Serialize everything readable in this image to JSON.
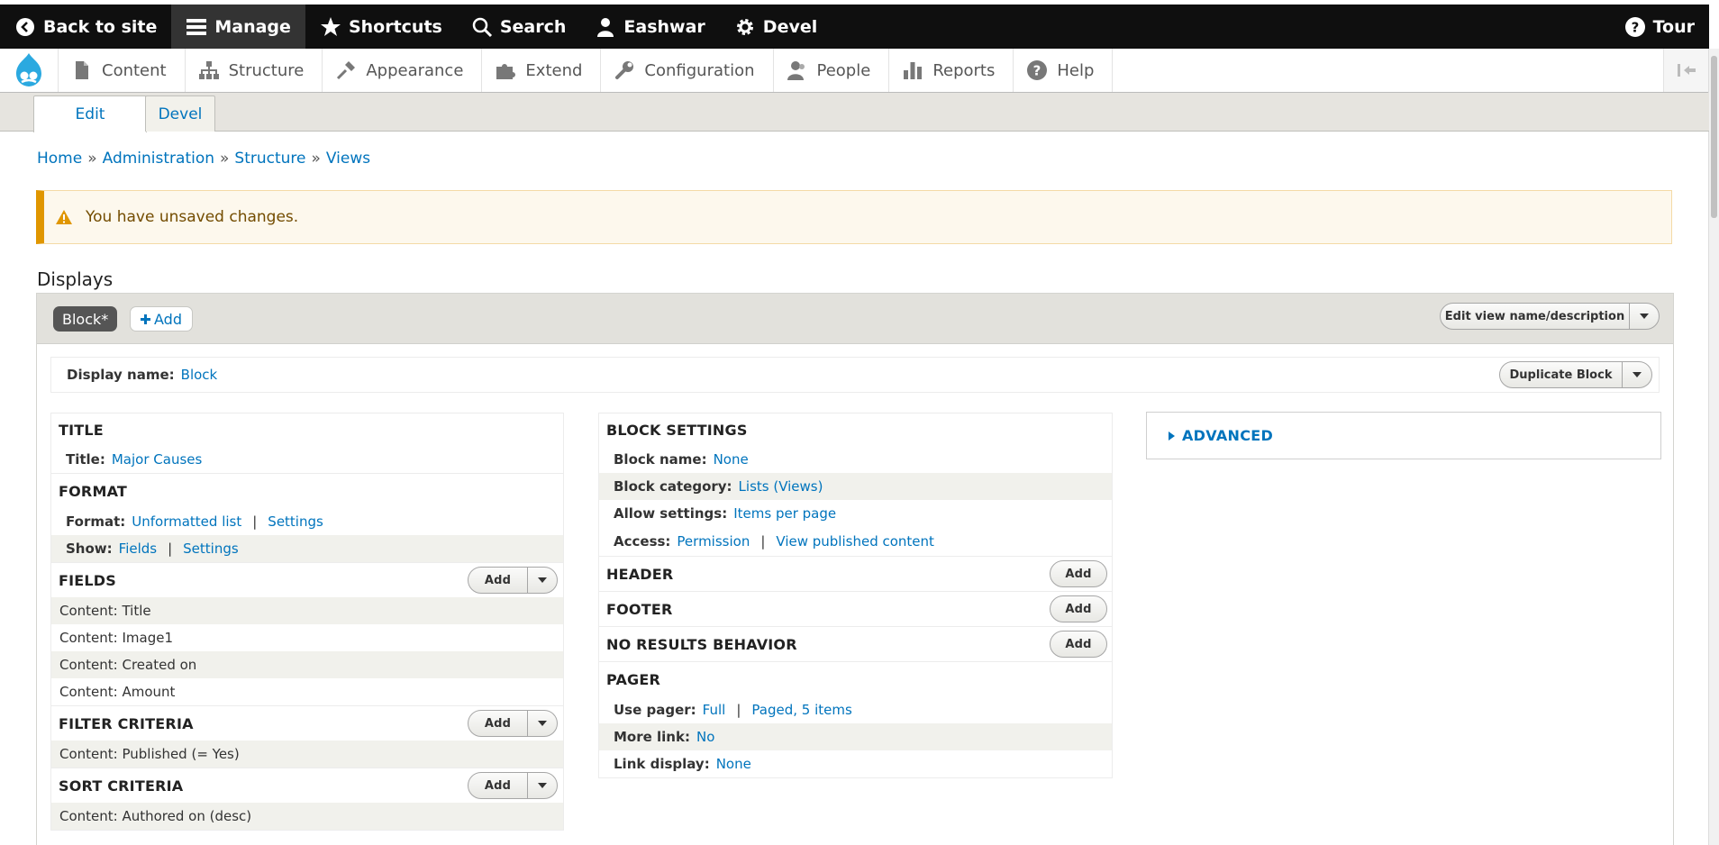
{
  "toolbar": {
    "back": "Back to site",
    "manage": "Manage",
    "shortcuts": "Shortcuts",
    "search": "Search",
    "user": "Eashwar",
    "devel": "Devel",
    "tour": "Tour"
  },
  "tray": {
    "items": [
      "Content",
      "Structure",
      "Appearance",
      "Extend",
      "Configuration",
      "People",
      "Reports",
      "Help"
    ]
  },
  "tabs": [
    "Edit",
    "Devel"
  ],
  "breadcrumb": [
    "Home",
    "Administration",
    "Structure",
    "Views"
  ],
  "breadcrumb_sep": "»",
  "warning": "You have unsaved changes.",
  "displays": {
    "title": "Displays",
    "active_display": "Block*",
    "add_label": "Add",
    "edit_view_button": "Edit view name/description",
    "display_name_label": "Display name:",
    "display_name_value": "Block",
    "duplicate_button": "Duplicate Block"
  },
  "left": {
    "title_section": "TITLE",
    "title_label": "Title:",
    "title_value": "Major Causes",
    "format_section": "FORMAT",
    "format_label": "Format:",
    "format_value": "Unformatted list",
    "settings": "Settings",
    "show_label": "Show:",
    "show_value": "Fields",
    "fields_section": "FIELDS",
    "fields": [
      "Content: Title",
      "Content: Image1",
      "Content: Created on",
      "Content: Amount"
    ],
    "filter_section": "FILTER CRITERIA",
    "filters": [
      "Content: Published (= Yes)"
    ],
    "sort_section": "SORT CRITERIA",
    "sorts": [
      "Content: Authored on (desc)"
    ],
    "add_button": "Add"
  },
  "middle": {
    "block_settings": "BLOCK SETTINGS",
    "block_name_label": "Block name:",
    "block_name_value": "None",
    "block_category_label": "Block category:",
    "block_category_value": "Lists (Views)",
    "allow_settings_label": "Allow settings:",
    "allow_settings_value": "Items per page",
    "access_label": "Access:",
    "access_value": "Permission",
    "access_value2": "View published content",
    "header": "HEADER",
    "footer": "FOOTER",
    "no_results": "NO RESULTS BEHAVIOR",
    "pager": "PAGER",
    "use_pager_label": "Use pager:",
    "use_pager_value": "Full",
    "use_pager_value2": "Paged, 5 items",
    "more_link_label": "More link:",
    "more_link_value": "No",
    "link_display_label": "Link display:",
    "link_display_value": "None",
    "add_button": "Add"
  },
  "right": {
    "advanced": "ADVANCED"
  },
  "colors": {
    "link": "#0074bd",
    "toolbar": "#0f0f0f",
    "warning_border": "#e09600"
  }
}
